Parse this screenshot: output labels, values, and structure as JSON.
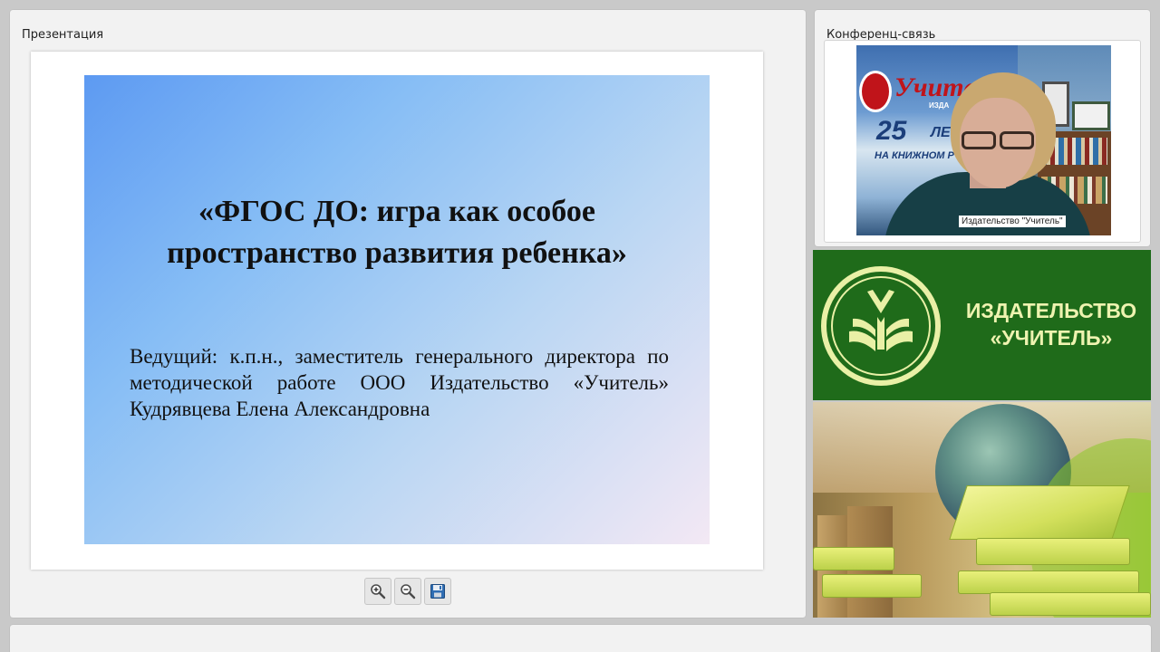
{
  "presentation": {
    "panel_title": "Презентация",
    "slide": {
      "title_line1": "«ФГОС ДО: игра как особое",
      "title_line2": "пространство развития ребенка»",
      "body": "Ведущий: к.п.н., заместитель генерального директора по методической работе ООО Издательство «Учитель» Кудрявцева Елена Александровна"
    },
    "toolbar": {
      "zoom_in_icon": "zoom-in-icon",
      "zoom_out_icon": "zoom-out-icon",
      "save_icon": "floppy-disk-icon"
    }
  },
  "conference": {
    "panel_title": "Конференц-связь",
    "video": {
      "participant_label": "Издательство \"Учитель\"",
      "poster_word": "Учите",
      "poster_sub": "ИЗДА",
      "poster_number": "25",
      "poster_number_suffix": "ЛЕТ",
      "poster_line": "НА КНИЖНОМ Р"
    }
  },
  "publisher_banner": {
    "name_line1": "ИЗДАТЕЛЬСТВО",
    "name_line2": "«УЧИТЕЛЬ»"
  },
  "colors": {
    "banner_green": "#1f6b1a",
    "banner_text": "#eef3b0",
    "slide_gradient_start": "#5d9af2",
    "slide_gradient_end": "#f3e8f4"
  }
}
